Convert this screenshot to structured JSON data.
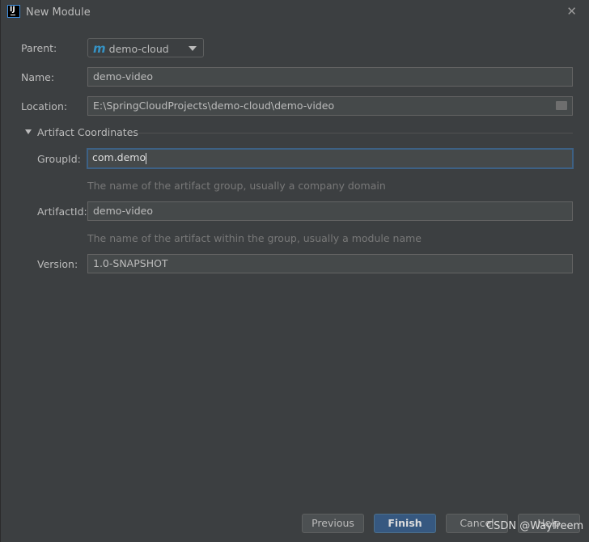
{
  "window": {
    "title": "New Module",
    "icon": "intellij-logo",
    "logo_text": "IJ",
    "close_icon": "close-icon"
  },
  "form": {
    "parent_label": "Parent:",
    "parent_value": "demo-cloud",
    "parent_icon": "maven-module-icon",
    "name_label": "Name:",
    "name_value": "demo-video",
    "location_label": "Location:",
    "location_value": "E:\\SpringCloudProjects\\demo-cloud\\demo-video",
    "section_label": "Artifact Coordinates",
    "groupid_label": "GroupId:",
    "groupid_value": "com.demo",
    "groupid_hint": "The name of the artifact group, usually a company domain",
    "artifactid_label": "ArtifactId:",
    "artifactid_value": "demo-video",
    "artifactid_hint": "The name of the artifact within the group, usually a module name",
    "version_label": "Version:",
    "version_value": "1.0-SNAPSHOT"
  },
  "buttons": {
    "previous": "Previous",
    "finish": "Finish",
    "cancel": "Cancel",
    "help": "Help"
  },
  "watermark": "CSDN @Wayfreem",
  "colors": {
    "accent": "#365880",
    "focus": "#3d6185",
    "background": "#3c3f41"
  }
}
